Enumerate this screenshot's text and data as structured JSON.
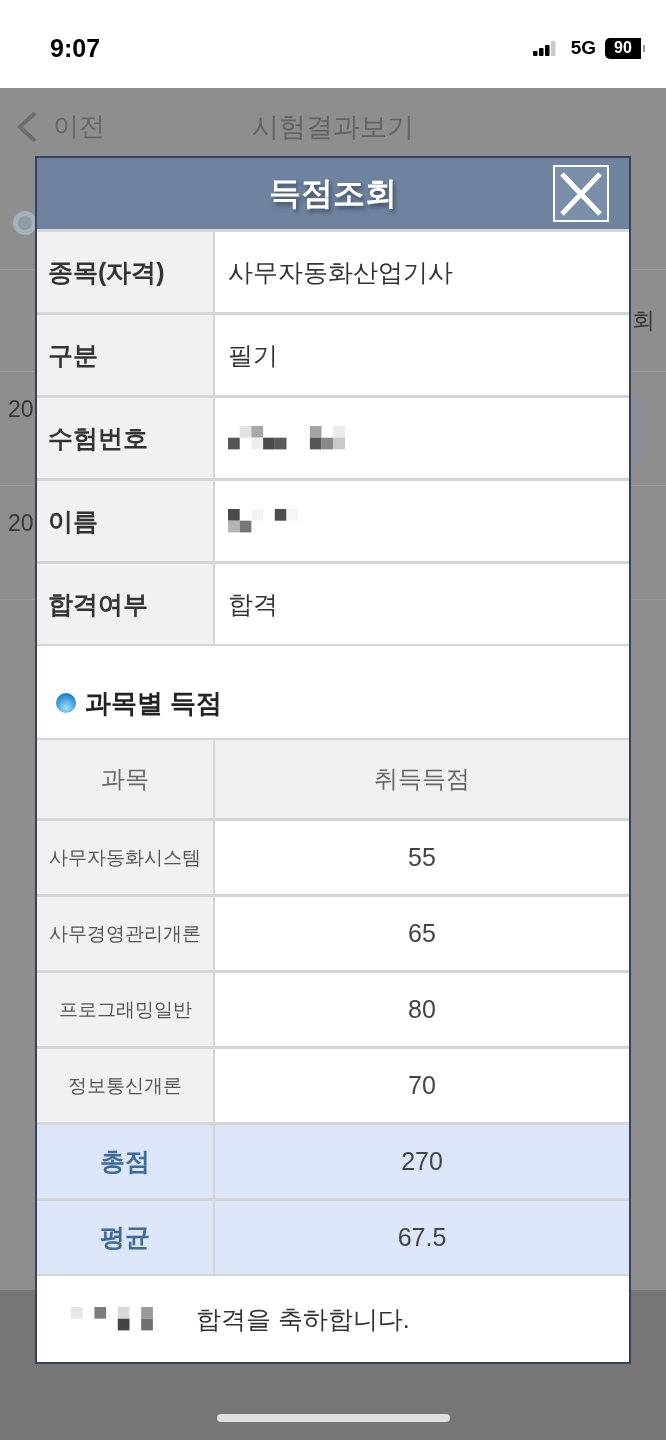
{
  "status_bar": {
    "time": "9:07",
    "network": "5G",
    "battery": "90"
  },
  "background_page": {
    "back_label": "이전",
    "title": "시험결과보기",
    "rows": [
      {
        "kind": "radio"
      },
      {
        "kind": "header",
        "text": "회"
      },
      {
        "kind": "item",
        "text": "20",
        "button": true
      },
      {
        "kind": "item",
        "text": "20",
        "button": false
      }
    ]
  },
  "dialog": {
    "title": "득점조회",
    "info_rows": [
      {
        "label": "종목(자격)",
        "value": "사무자동화산업기사",
        "redacted": false
      },
      {
        "label": "구분",
        "value": "필기",
        "redacted": false
      },
      {
        "label": "수험번호",
        "redacted": true
      },
      {
        "label": "이름",
        "redacted": true
      },
      {
        "label": "합격여부",
        "value": "합격",
        "redacted": false
      }
    ],
    "scores": {
      "heading": "과목별 득점",
      "columns": [
        "과목",
        "취득득점"
      ],
      "rows": [
        {
          "subject": "사무자동화시스템",
          "score": "55"
        },
        {
          "subject": "사무경영관리개론",
          "score": "65"
        },
        {
          "subject": "프로그래밍일반",
          "score": "80"
        },
        {
          "subject": "정보통신개론",
          "score": "70"
        }
      ],
      "summary_rows": [
        {
          "label": "총점",
          "value": "270"
        },
        {
          "label": "평균",
          "value": "67.5"
        }
      ]
    },
    "message": {
      "redacted_name": true,
      "text": "합격을 축하합니다."
    }
  }
}
